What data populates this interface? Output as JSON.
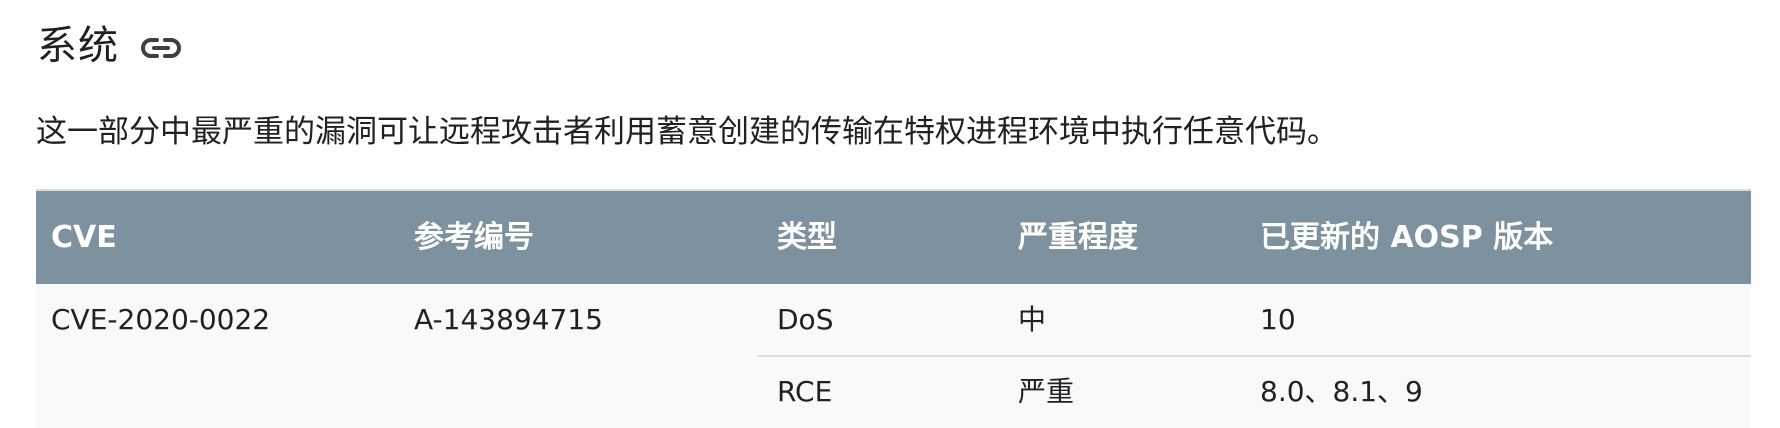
{
  "section": {
    "title": "系统",
    "link_icon": "link-icon"
  },
  "intro": "这一部分中最严重的漏洞可让远程攻击者利用蓄意创建的传输在特权进程环境中执行任意代码。",
  "table": {
    "headers": [
      "CVE",
      "参考编号",
      "类型",
      "严重程度",
      "已更新的 AOSP 版本"
    ],
    "rows": [
      {
        "cve": "CVE-2020-0022",
        "reference": "A-143894715",
        "entries": [
          {
            "type": "DoS",
            "severity": "中",
            "versions": "10"
          },
          {
            "type": "RCE",
            "severity": "严重",
            "versions": "8.0、8.1、9"
          }
        ]
      }
    ]
  },
  "colors": {
    "header_bg": "#7e919e",
    "body_bg": "#f8f9fa",
    "text": "#202124"
  }
}
